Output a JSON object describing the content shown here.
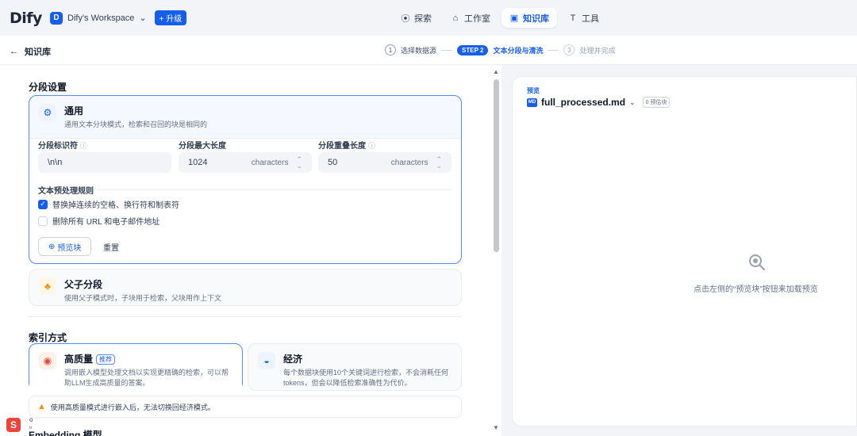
{
  "brand": {
    "logo_text": "Dify",
    "accent": "#155eef"
  },
  "workspace": {
    "avatar_letter": "D",
    "name": "Dify's Workspace",
    "chevron": "⌄",
    "upgrade_label": "+ 升级"
  },
  "nav": {
    "items": [
      {
        "label": "探索",
        "icon": "compass-icon",
        "glyph": "⦿"
      },
      {
        "label": "工作室",
        "icon": "studio-icon",
        "glyph": "⌂"
      },
      {
        "label": "知识库",
        "icon": "book-icon",
        "glyph": "▣"
      },
      {
        "label": "工具",
        "icon": "tool-icon",
        "glyph": "T"
      }
    ]
  },
  "subheader": {
    "back_label": "知识库",
    "steps": [
      {
        "num": "1",
        "label": "选择数据源"
      },
      {
        "badge": "STEP 2",
        "label": "文本分段与清洗"
      },
      {
        "num": "3",
        "label": "处理并完成"
      }
    ]
  },
  "segmentation": {
    "section_title": "分段设置",
    "general": {
      "title": "通用",
      "desc": "通用文本分块模式，检索和召回的块是相同的"
    },
    "fields": {
      "separator_label": "分段标识符",
      "separator_value": "\\n\\n",
      "max_length_label": "分段最大长度",
      "max_length_value": "1024",
      "overlap_label": "分段重叠长度",
      "overlap_value": "50",
      "unit": "characters"
    },
    "rules_title": "文本预处理规则",
    "rules": [
      {
        "label": "替换掉连续的空格、换行符和制表符",
        "checked": true
      },
      {
        "label": "删除所有 URL 和电子邮件地址",
        "checked": false
      }
    ],
    "preview_button": "预览块",
    "reset_button": "重置",
    "parent_child": {
      "title": "父子分段",
      "desc": "使用父子模式时，子块用于检索，父块用作上下文"
    }
  },
  "index": {
    "section_title": "索引方式",
    "high_quality": {
      "title": "高质量",
      "tag": "推荐",
      "desc": "调用嵌入模型处理文档以实现更精确的检索，可以帮助LLM生成高质量的答案。"
    },
    "economy": {
      "title": "经济",
      "desc": "每个数据块使用10个关键词进行检索，不会消耗任何tokens，但会以降低检索准确性为代价。"
    },
    "warning": "使用高质量模式进行嵌入后，无法切换回经济模式。",
    "next_section_partial": "Embedding 模型"
  },
  "preview": {
    "label": "预览",
    "file_icon": "MD",
    "file_name": "full_processed.md",
    "count_badge": "0 预估块",
    "empty_text": "点击左侧的“预览块”按钮来加载预览"
  }
}
